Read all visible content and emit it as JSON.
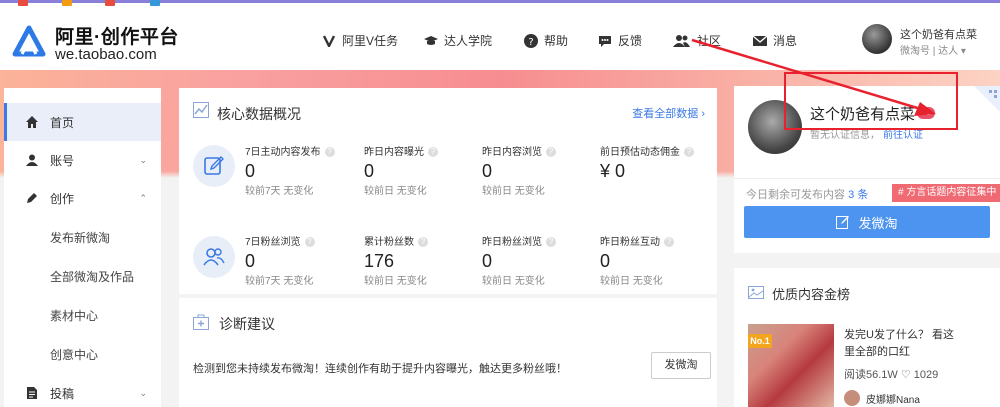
{
  "header": {
    "logo_title": "阿里·创作平台",
    "logo_url": "we.taobao.com",
    "nav": [
      {
        "label": "阿里V任务",
        "icon": "v-icon"
      },
      {
        "label": "达人学院",
        "icon": "graduation-cap-icon"
      },
      {
        "label": "帮助",
        "icon": "help-icon"
      },
      {
        "label": "反馈",
        "icon": "feedback-icon"
      },
      {
        "label": "社区",
        "icon": "community-icon"
      },
      {
        "label": "消息",
        "icon": "mail-icon"
      }
    ],
    "user": {
      "name": "这个奶爸有点菜",
      "sub": "微淘号 | 达人 ▾"
    }
  },
  "sidebar": {
    "items": [
      {
        "label": "首页",
        "icon": "home-icon",
        "active": true
      },
      {
        "label": "账号",
        "icon": "user-icon",
        "chevron": "⌄"
      },
      {
        "label": "创作",
        "icon": "pencil-icon",
        "chevron": "⌃"
      },
      {
        "label": "发布新微淘",
        "sub": true
      },
      {
        "label": "全部微淘及作品",
        "sub": true
      },
      {
        "label": "素材中心",
        "sub": true
      },
      {
        "label": "创意中心",
        "sub": true
      },
      {
        "label": "投稿",
        "icon": "document-icon",
        "chevron": "⌄"
      }
    ]
  },
  "overview": {
    "title": "核心数据概况",
    "link": "查看全部数据",
    "row1": [
      {
        "label": "7日主动内容发布",
        "value": "0",
        "compare": "较前7天 无变化"
      },
      {
        "label": "昨日内容曝光",
        "value": "0",
        "compare": "较前日 无变化"
      },
      {
        "label": "昨日内容浏览",
        "value": "0",
        "compare": "较前日 无变化"
      },
      {
        "label": "前日预估动态佣金",
        "value": "¥ 0",
        "compare": ""
      }
    ],
    "row2": [
      {
        "label": "7日粉丝浏览",
        "value": "0",
        "compare": "较前7天 无变化"
      },
      {
        "label": "累计粉丝数",
        "value": "176",
        "compare": "较前日 无变化"
      },
      {
        "label": "昨日粉丝浏览",
        "value": "0",
        "compare": "较前日 无变化"
      },
      {
        "label": "昨日粉丝互动",
        "value": "0",
        "compare": "较前日 无变化"
      }
    ]
  },
  "diagnosis": {
    "title": "诊断建议",
    "text": "检测到您未持续发布微淘！连续创作有助于提升内容曝光，触达更多粉丝哦！",
    "button": "发微淘"
  },
  "profile": {
    "name": "这个奶爸有点菜",
    "level": "L1",
    "auth_text": "暂无认证信息",
    "auth_link": "前往认证",
    "remain_prefix": "今日剩余可发布内容",
    "remain_count": "3 条",
    "tag": "# 方言话题内容征集中",
    "publish_button": "发微淘"
  },
  "gold": {
    "title": "优质内容金榜",
    "rank": "No.1",
    "line1": "发完U发了什么？ 看这",
    "line2": "里全部的口红",
    "line3": "阅读56.1W  ♡ 1029",
    "author": "皮娜娜Nana"
  },
  "colors": {
    "accent": "#3a79e6",
    "button": "#4d93f0",
    "annotation": "#e8212e",
    "tag": "#ef6a73"
  }
}
